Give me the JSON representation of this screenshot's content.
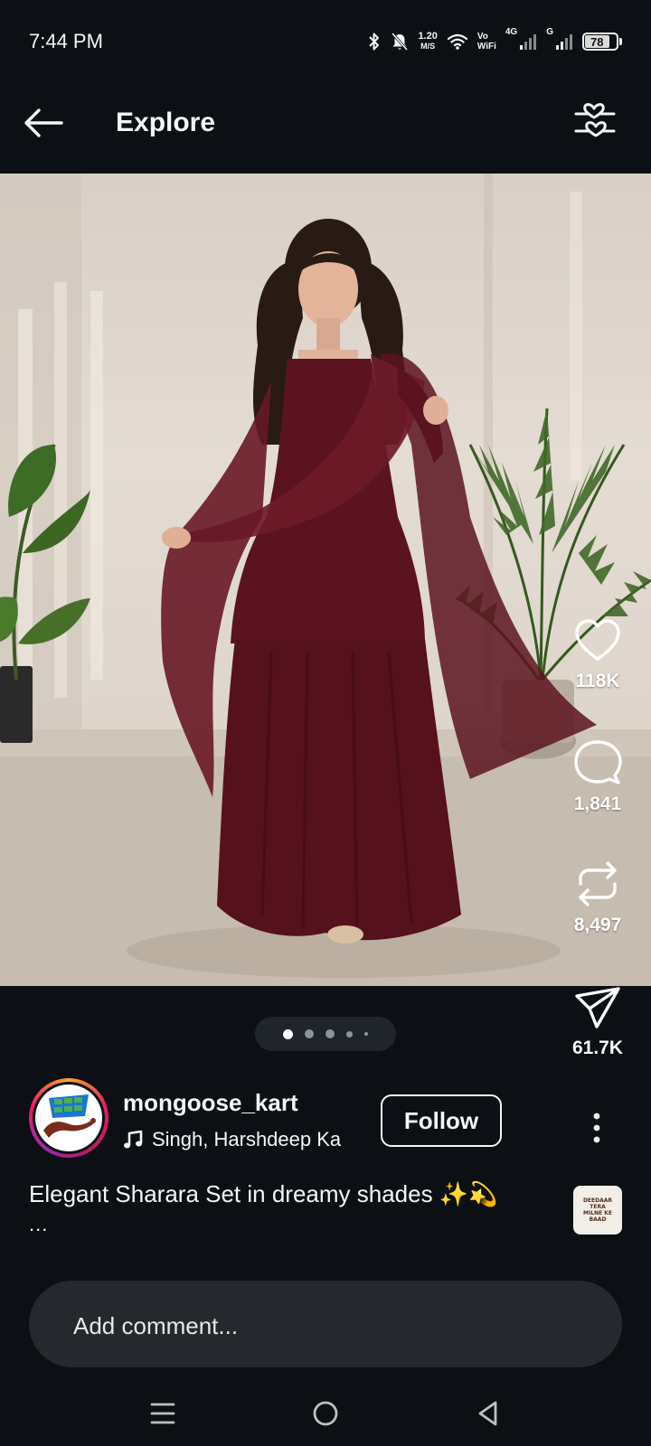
{
  "status_bar": {
    "time": "7:44 PM",
    "net_speed_value": "1.20",
    "net_speed_unit": "M/S",
    "vowifi_top": "Vo",
    "vowifi_bottom": "WiFi",
    "network_4g": "4G",
    "network_g": "G",
    "battery_level": "78",
    "icons": [
      "bluetooth-icon",
      "mute-bell-icon",
      "wifi-icon",
      "signal-icon",
      "battery-icon"
    ]
  },
  "header": {
    "title": "Explore",
    "back_icon": "arrow-left-icon",
    "filter_icon": "heart-sliders-icon"
  },
  "actions": {
    "likes": "118K",
    "comments": "1,841",
    "reposts": "8,497",
    "shares": "61.7K"
  },
  "carousel": {
    "total": 5,
    "active": 1
  },
  "post": {
    "username": "mongoose_kart",
    "audio": "Singh, Harshdeep Ka",
    "follow_label": "Follow",
    "caption": "Elegant Sharara Set in dreamy shades ✨💫",
    "caption_more": "...",
    "audio_thumb_lines": [
      "DEEDAAR",
      "TERA",
      "MILNE KE",
      "BAAD"
    ]
  },
  "comment": {
    "placeholder": "Add comment..."
  },
  "colors": {
    "background": "#0c1014",
    "dress": "#5c1420",
    "wall": "#e4dcd3",
    "comment_bar": "#25292e",
    "avatar_ring": "#e91e63"
  }
}
